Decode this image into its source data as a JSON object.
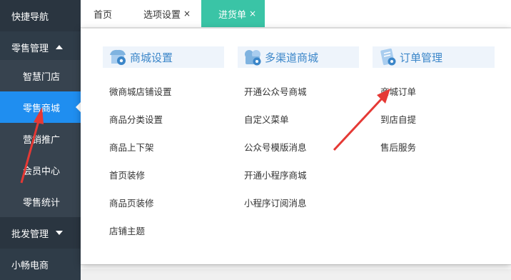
{
  "sidebar": {
    "quick_nav": "快捷导航",
    "retail_group": "零售管理",
    "retail_items": [
      "智慧门店",
      "零售商城",
      "营销推广",
      "会员中心",
      "零售统计"
    ],
    "wholesale_group": "批发管理",
    "ecommerce_item": "小畅电商"
  },
  "tabs": [
    {
      "label": "首页"
    },
    {
      "label": "选项设置",
      "close": "×"
    },
    {
      "label": "进货单",
      "close": "×"
    }
  ],
  "panel": {
    "columns": [
      {
        "title": "商城设置",
        "icon": "shop-settings-icon",
        "links": [
          "微商城店铺设置",
          "商品分类设置",
          "商品上下架",
          "首页装修",
          "商品页装修",
          "店铺主题"
        ]
      },
      {
        "title": "多渠道商城",
        "icon": "multichannel-shop-icon",
        "links": [
          "开通公众号商城",
          "自定义菜单",
          "公众号模版消息",
          "开通小程序商城",
          "小程序订阅消息"
        ]
      },
      {
        "title": "订单管理",
        "icon": "order-management-icon",
        "links": [
          "商城订单",
          "到店自提",
          "售后服务"
        ]
      }
    ]
  },
  "colors": {
    "sidebar_bg": "#2f3c48",
    "active_blue": "#1f8ef0",
    "active_tab": "#3ac4a6",
    "header_title": "#3b86c9",
    "annotation_arrow": "#e53935"
  }
}
